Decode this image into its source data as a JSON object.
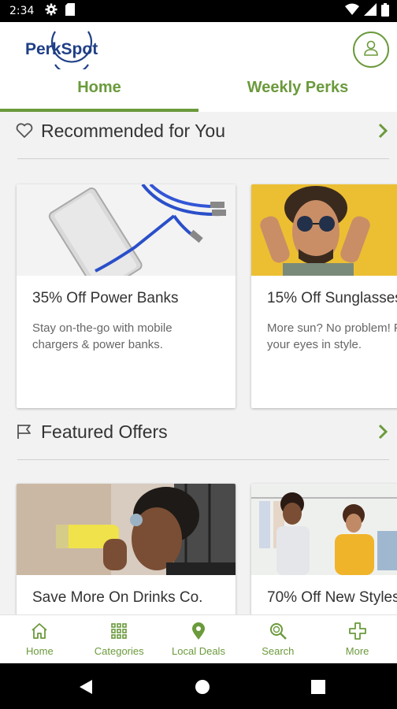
{
  "status_bar": {
    "time": "2:34"
  },
  "header": {
    "logo_text": "PerkSpot",
    "tabs": [
      {
        "label": "Home",
        "active": true
      },
      {
        "label": "Weekly Perks",
        "active": false
      }
    ]
  },
  "sections": [
    {
      "title": "Recommended for You",
      "icon": "heart-icon",
      "cards": [
        {
          "title": "35% Off Power Banks",
          "description": "Stay on-the-go with mobile chargers & power banks."
        },
        {
          "title": "15% Off Sunglasses",
          "description": "More sun? No problem! Protect your eyes in style."
        }
      ]
    },
    {
      "title": "Featured Offers",
      "icon": "flag-icon",
      "cards": [
        {
          "title": "Save More On Drinks Co.",
          "description": ""
        },
        {
          "title": "70% Off New Styles",
          "description": ""
        }
      ]
    }
  ],
  "bottom_nav": [
    {
      "label": "Home",
      "icon": "home-icon"
    },
    {
      "label": "Categories",
      "icon": "grid-icon"
    },
    {
      "label": "Local Deals",
      "icon": "map-pin-icon"
    },
    {
      "label": "Search",
      "icon": "search-icon"
    },
    {
      "label": "More",
      "icon": "plus-icon"
    }
  ],
  "colors": {
    "accent": "#6b9a3c",
    "logo_blue": "#1f3f86",
    "background": "#f2f2f2"
  }
}
